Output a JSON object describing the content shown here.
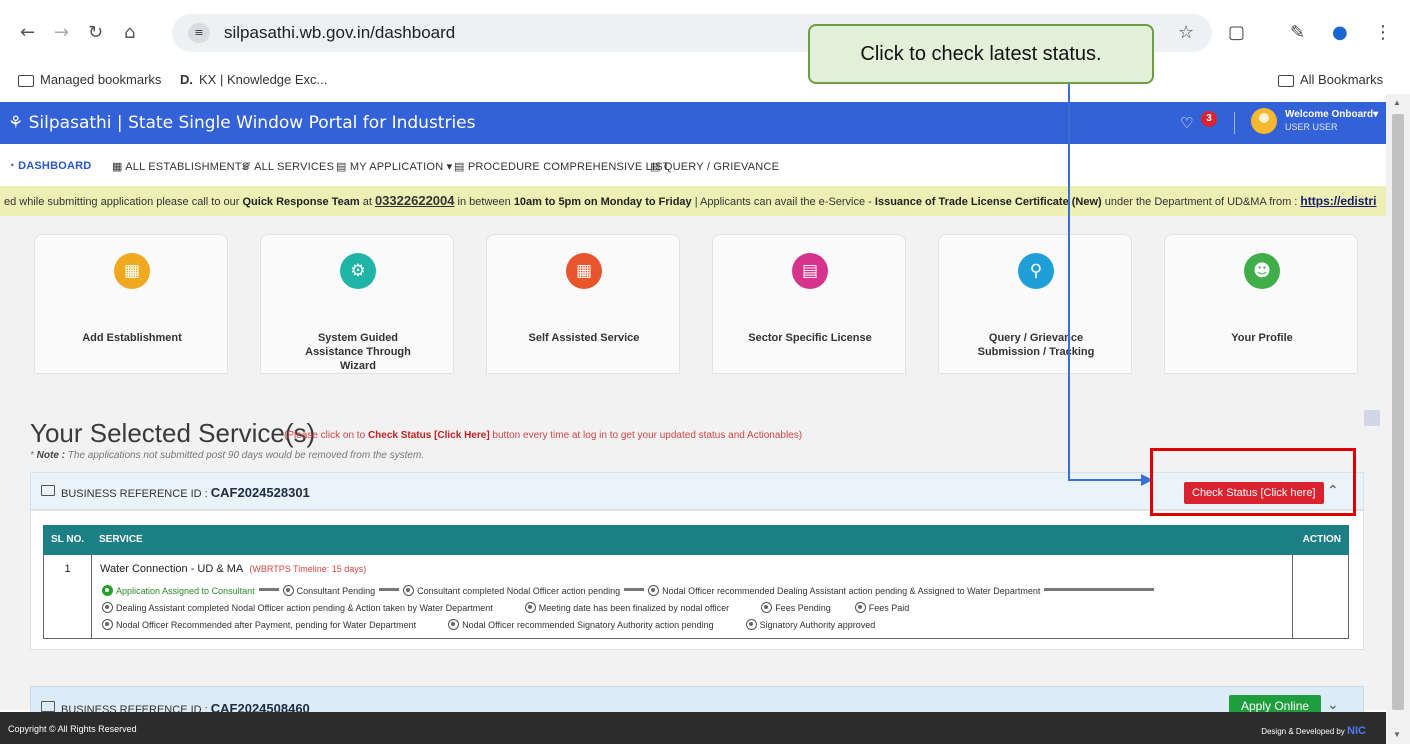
{
  "browser": {
    "url": "silpasathi.wb.gov.in/dashboard",
    "bookmarks": [
      {
        "label": "Managed bookmarks"
      },
      {
        "label": "KX | Knowledge Exc..."
      }
    ],
    "bookmarks_right": "All Bookmarks"
  },
  "tooltip": "Click to check latest status.",
  "header": {
    "brand": "ພ Silpasathi | State Single Window Portal for Industries",
    "notification_count": "3",
    "welcome": "Welcome Onboard",
    "user": "USER USER"
  },
  "menu": [
    "DASHBOARD",
    "ALL ESTABLISHMENTS",
    "ALL SERVICES",
    "MY APPLICATION",
    "PROCEDURE COMPREHENSIVE LIST",
    "QUERY / GRIEVANCE"
  ],
  "ticker": {
    "t1": "ed while submitting application please call to our ",
    "qrt": "Quick Response Team",
    "t2": " at ",
    "phone": "03322622004",
    "t3": " in between ",
    "hours": "10am to 5pm on Monday to Friday",
    "t4": " | Applicants can avail the e-Service - ",
    "svc": "Issuance of Trade License Certificate (New)",
    "t5": " under the Department of UD&MA from : ",
    "link": "https://edistri"
  },
  "cards": [
    {
      "label": "Add Establishment",
      "icon": "building-icon",
      "color": "#f0a820"
    },
    {
      "label": "System Guided Assistance Through Wizard",
      "icon": "gear-icon",
      "color": "#1fb5a6"
    },
    {
      "label": "Self Assisted Service",
      "icon": "grid-check-icon",
      "color": "#e8552a"
    },
    {
      "label": "Sector Specific License",
      "icon": "license-icon",
      "color": "#d6348c"
    },
    {
      "label": "Query / Grievance Submission / Tracking",
      "icon": "search-icon",
      "color": "#1e9fd8"
    },
    {
      "label": "Your Profile",
      "icon": "profile-icon",
      "color": "#3fae49"
    }
  ],
  "section": {
    "title": "Your Selected Service(s)",
    "hint_pre": "(Please click on to ",
    "hint_bold": "Check Status [Click Here]",
    "hint_post": " button every time at log in to get your updated status and Actionables)",
    "note_bold": "Note :",
    "note": " The applications not submitted post 90 days would be removed from the system.",
    "note_prefix": "* "
  },
  "business1": {
    "label": "BUSINESS REFERENCE ID :",
    "id": "CAF2024528301",
    "button": "Check Status [Click here]"
  },
  "table": {
    "headers": [
      "SL NO.",
      "SERVICE",
      "ACTION"
    ],
    "row": {
      "sl": "1",
      "service": "Water Connection - UD & MA",
      "timeline": "(WBRTPS Timeline: 15 days)",
      "steps": [
        {
          "label": "Application Assigned to Consultant",
          "done": true
        },
        {
          "label": "Consultant Pending",
          "done": false
        },
        {
          "label": "Consultant completed Nodal Officer action pending",
          "done": false
        },
        {
          "label": "Nodal Officer recommended Dealing Assistant action pending & Assigned to Water Department",
          "done": false
        },
        {
          "label": "Dealing Assistant completed Nodal Officer action pending & Action taken by Water Department",
          "done": false
        },
        {
          "label": "Meeting date has been finalized by nodal officer",
          "done": false
        },
        {
          "label": "Fees Pending",
          "done": false
        },
        {
          "label": "Fees Paid",
          "done": false
        },
        {
          "label": "Nodal Officer Recommended after Payment, pending for Water Department",
          "done": false
        },
        {
          "label": "Nodal Officer recommended Signatory Authority action pending",
          "done": false
        },
        {
          "label": "Signatory Authority approved",
          "done": false
        }
      ]
    }
  },
  "business2": {
    "label": "BUSINESS REFERENCE ID :",
    "id": "CAF2024508460",
    "button": "Apply Online"
  },
  "footer": {
    "left": "Copyright © All Rights Reserved",
    "right": "Design & Developed by",
    "nic": "NIC"
  }
}
